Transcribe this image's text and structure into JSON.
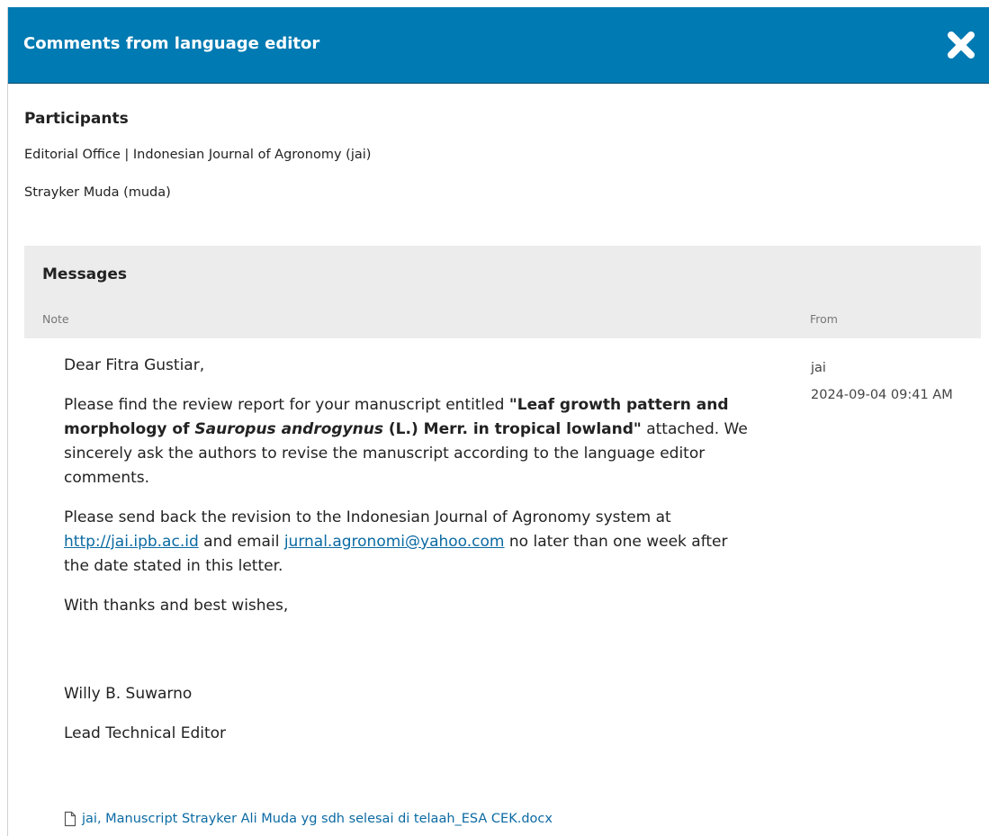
{
  "modal": {
    "title": "Comments from language editor",
    "header_color": "#007ab2"
  },
  "participants": {
    "heading": "Participants",
    "items": [
      "Editorial Office | Indonesian Journal of Agronomy (jai)",
      "Strayker Muda (muda)"
    ]
  },
  "messages": {
    "heading": "Messages",
    "columns": {
      "note": "Note",
      "from": "From"
    },
    "message": {
      "greeting": "Dear Fitra Gustiar,",
      "p1_before": "Please find the review report for your manuscript entitled ",
      "p1_title_a": "\"Leaf growth pattern and morphology of ",
      "p1_title_species": "Sauropus androgynus",
      "p1_title_b": " (L.) Merr. in tropical lowland\"",
      "p1_after": " attached. We sincerely ask the authors to revise the manuscript according to the language editor comments.",
      "p2_before": "Please send back the revision to the Indonesian Journal of Agronomy system at ",
      "p2_link1": "http://jai.ipb.ac.id",
      "p2_mid": " and email ",
      "p2_link2": "jurnal.agronomi@yahoo.com",
      "p2_after": " no later than one week after the date stated in this letter.",
      "closing": "With thanks and best wishes,",
      "signer_name": "Willy B. Suwarno",
      "signer_title": "Lead Technical Editor",
      "from_user": "jai",
      "from_date": "2024-09-04 09:41 AM",
      "attachment": "jai, Manuscript Strayker Ali Muda yg sdh selesai di telaah_ESA CEK.docx"
    }
  },
  "icons": {
    "close": "close-icon",
    "file": "file-icon"
  },
  "colors": {
    "link": "#0b6aa3",
    "messages_bg": "#ececec"
  }
}
